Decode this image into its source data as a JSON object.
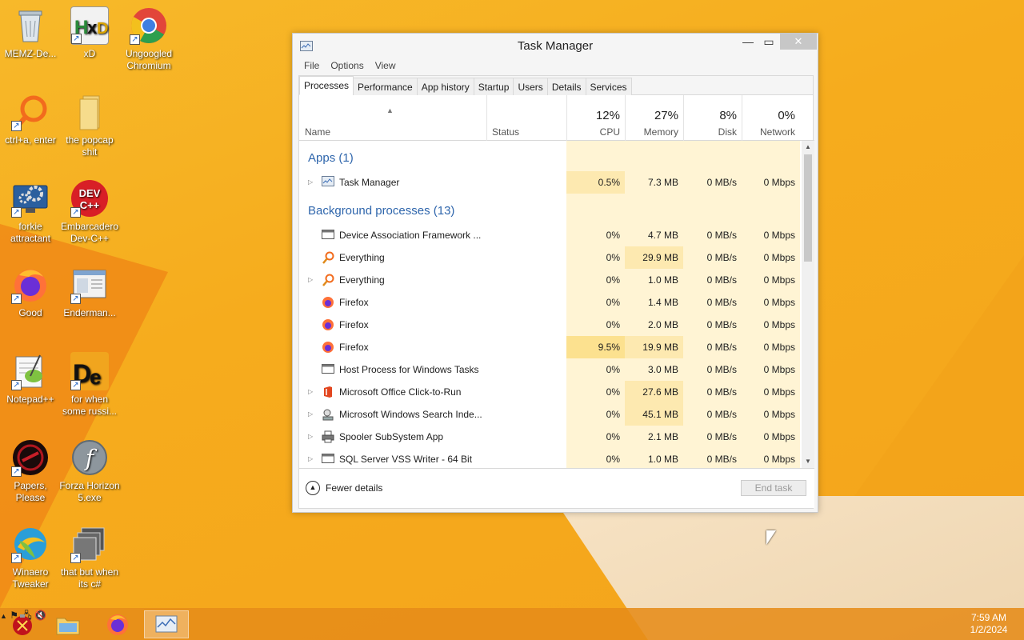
{
  "desktop": {
    "icons": [
      {
        "label": "MEMZ-De...",
        "icon": "recycle-bin-icon"
      },
      {
        "label": "xD",
        "icon": "hxd-icon"
      },
      {
        "label": "Ungoogled Chromium",
        "icon": "chromium-icon"
      },
      {
        "label": "ctrl+a, enter",
        "icon": "everything-icon"
      },
      {
        "label": "the popcap shit",
        "icon": "folder-icon"
      },
      {
        "label": "forkie attractant",
        "icon": "settings-computer-icon"
      },
      {
        "label": "Embarcadero Dev-C++",
        "icon": "devcpp-icon"
      },
      {
        "label": "Good",
        "icon": "firefox-icon"
      },
      {
        "label": "Enderman...",
        "icon": "window-icon"
      },
      {
        "label": "Notepad++",
        "icon": "notepadpp-icon"
      },
      {
        "label": "for when some russi...",
        "icon": "de-icon"
      },
      {
        "label": "Papers, Please",
        "icon": "papers-please-icon"
      },
      {
        "label": "Forza Horizon 5.exe",
        "icon": "flash-icon"
      },
      {
        "label": "Winaero Tweaker",
        "icon": "winaero-icon"
      },
      {
        "label": "that but when its c#",
        "icon": "stack-icon"
      }
    ]
  },
  "window": {
    "title": "Task Manager",
    "menu": [
      "File",
      "Options",
      "View"
    ],
    "tabs": [
      "Processes",
      "Performance",
      "App history",
      "Startup",
      "Users",
      "Details",
      "Services"
    ],
    "header": {
      "name": "Name",
      "status": "Status",
      "cpu_pct": "12%",
      "cpu": "CPU",
      "mem_pct": "27%",
      "mem": "Memory",
      "disk_pct": "8%",
      "disk": "Disk",
      "net_pct": "0%",
      "net": "Network"
    },
    "groups": {
      "apps": "Apps (1)",
      "background": "Background processes (13)"
    },
    "apps": [
      {
        "name": "Task Manager",
        "cpu": "0.5%",
        "mem": "7.3 MB",
        "disk": "0 MB/s",
        "net": "0 Mbps",
        "expandable": true,
        "icon": "taskmgr-icon"
      }
    ],
    "processes": [
      {
        "name": "Device Association Framework ...",
        "cpu": "0%",
        "mem": "4.7 MB",
        "disk": "0 MB/s",
        "net": "0 Mbps",
        "expandable": false,
        "icon": "service-window-icon"
      },
      {
        "name": "Everything",
        "cpu": "0%",
        "mem": "29.9 MB",
        "disk": "0 MB/s",
        "net": "0 Mbps",
        "expandable": false,
        "icon": "everything-icon"
      },
      {
        "name": "Everything",
        "cpu": "0%",
        "mem": "1.0 MB",
        "disk": "0 MB/s",
        "net": "0 Mbps",
        "expandable": true,
        "icon": "everything-icon"
      },
      {
        "name": "Firefox",
        "cpu": "0%",
        "mem": "1.4 MB",
        "disk": "0 MB/s",
        "net": "0 Mbps",
        "expandable": false,
        "icon": "firefox-icon"
      },
      {
        "name": "Firefox",
        "cpu": "0%",
        "mem": "2.0 MB",
        "disk": "0 MB/s",
        "net": "0 Mbps",
        "expandable": false,
        "icon": "firefox-icon"
      },
      {
        "name": "Firefox",
        "cpu": "9.5%",
        "mem": "19.9 MB",
        "disk": "0 MB/s",
        "net": "0 Mbps",
        "expandable": false,
        "icon": "firefox-icon"
      },
      {
        "name": "Host Process for Windows Tasks",
        "cpu": "0%",
        "mem": "3.0 MB",
        "disk": "0 MB/s",
        "net": "0 Mbps",
        "expandable": false,
        "icon": "service-window-icon"
      },
      {
        "name": "Microsoft Office Click-to-Run",
        "cpu": "0%",
        "mem": "27.6 MB",
        "disk": "0 MB/s",
        "net": "0 Mbps",
        "expandable": true,
        "icon": "office-icon"
      },
      {
        "name": "Microsoft Windows Search Inde...",
        "cpu": "0%",
        "mem": "45.1 MB",
        "disk": "0 MB/s",
        "net": "0 Mbps",
        "expandable": true,
        "icon": "search-indexer-icon"
      },
      {
        "name": "Spooler SubSystem App",
        "cpu": "0%",
        "mem": "2.1 MB",
        "disk": "0 MB/s",
        "net": "0 Mbps",
        "expandable": true,
        "icon": "printer-icon"
      },
      {
        "name": "SQL Server VSS Writer - 64 Bit",
        "cpu": "0%",
        "mem": "1.0 MB",
        "disk": "0 MB/s",
        "net": "0 Mbps",
        "expandable": true,
        "icon": "service-window-icon"
      }
    ],
    "footer": {
      "fewer_details": "Fewer details",
      "end_task": "End task"
    }
  },
  "taskbar": {
    "items": [
      "start-orb-icon",
      "file-explorer-icon",
      "firefox-icon",
      "task-manager-icon"
    ],
    "clock_time": "7:59 AM",
    "clock_date": "1/2/2024"
  },
  "colors": {
    "heat_light": "#fff4d4",
    "heat_mid": "#fde9b0",
    "heat_high": "#fce18f",
    "group_title": "#2f66ac",
    "taskbar": "#e68c19"
  }
}
